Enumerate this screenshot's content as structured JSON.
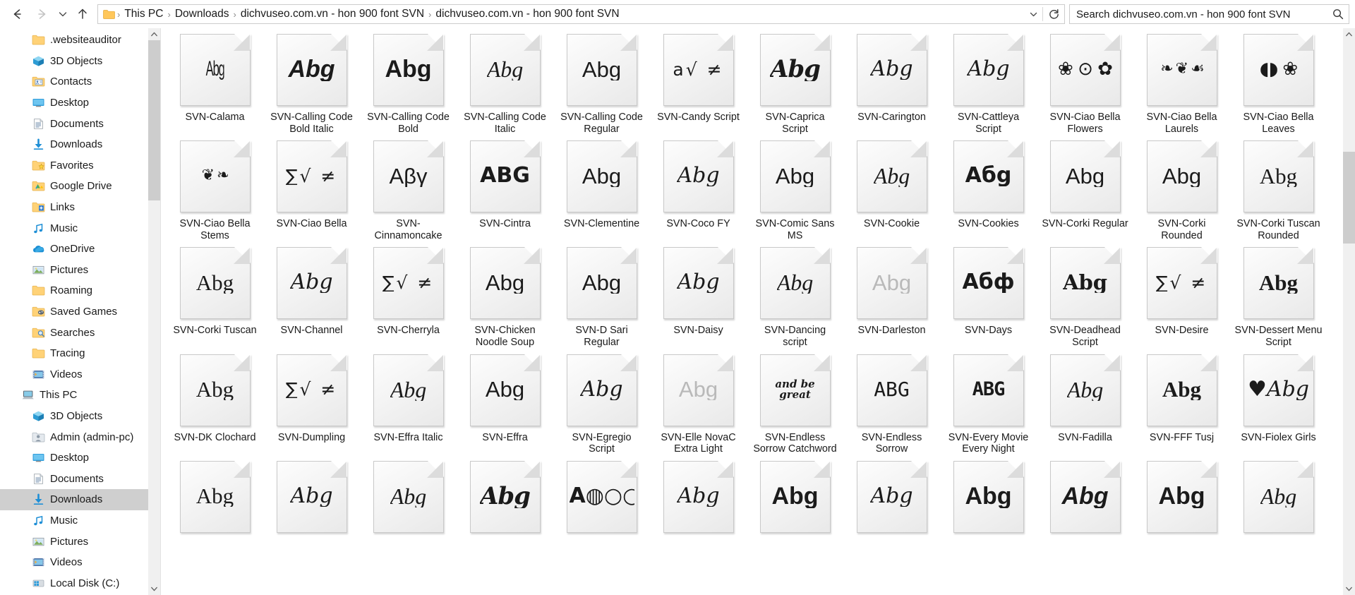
{
  "window": {
    "title": "dichvuseo.com.vn - hon 900 font SVN"
  },
  "toolbar": {
    "back_icon": "arrow-left-icon",
    "forward_icon": "arrow-right-icon",
    "recent_icon": "chevron-down-icon",
    "up_icon": "arrow-up-icon",
    "folder_icon": "folder-icon",
    "dropdown_icon": "chevron-down-icon",
    "refresh_icon": "refresh-icon",
    "search_icon": "search-icon"
  },
  "breadcrumb": {
    "separator": "›",
    "items": [
      "This PC",
      "Downloads",
      "dichvuseo.com.vn - hon 900 font SVN",
      "dichvuseo.com.vn - hon 900 font SVN"
    ]
  },
  "search": {
    "placeholder": "Search dichvuseo.com.vn - hon 900 font SVN",
    "value": ""
  },
  "sidebar": {
    "scroll_up_icon": "chevron-up-icon",
    "scroll_down_icon": "chevron-down-icon",
    "items": [
      {
        "label": ".websiteauditor",
        "icon": "folder-icon",
        "indent": 1,
        "selected": false
      },
      {
        "label": "3D Objects",
        "icon": "3d-objects-icon",
        "indent": 1,
        "selected": false
      },
      {
        "label": "Contacts",
        "icon": "contacts-icon",
        "indent": 1,
        "selected": false
      },
      {
        "label": "Desktop",
        "icon": "desktop-icon",
        "indent": 1,
        "selected": false
      },
      {
        "label": "Documents",
        "icon": "documents-icon",
        "indent": 1,
        "selected": false
      },
      {
        "label": "Downloads",
        "icon": "downloads-icon",
        "indent": 1,
        "selected": false
      },
      {
        "label": "Favorites",
        "icon": "favorites-icon",
        "indent": 1,
        "selected": false
      },
      {
        "label": "Google Drive",
        "icon": "google-drive-icon",
        "indent": 1,
        "selected": false
      },
      {
        "label": "Links",
        "icon": "links-icon",
        "indent": 1,
        "selected": false
      },
      {
        "label": "Music",
        "icon": "music-icon",
        "indent": 1,
        "selected": false
      },
      {
        "label": "OneDrive",
        "icon": "onedrive-icon",
        "indent": 1,
        "selected": false
      },
      {
        "label": "Pictures",
        "icon": "pictures-icon",
        "indent": 1,
        "selected": false
      },
      {
        "label": "Roaming",
        "icon": "folder-icon",
        "indent": 1,
        "selected": false
      },
      {
        "label": "Saved Games",
        "icon": "saved-games-icon",
        "indent": 1,
        "selected": false
      },
      {
        "label": "Searches",
        "icon": "searches-icon",
        "indent": 1,
        "selected": false
      },
      {
        "label": "Tracing",
        "icon": "folder-icon",
        "indent": 1,
        "selected": false
      },
      {
        "label": "Videos",
        "icon": "videos-icon",
        "indent": 1,
        "selected": false
      },
      {
        "label": "This PC",
        "icon": "this-pc-icon",
        "indent": 0,
        "selected": false
      },
      {
        "label": "3D Objects",
        "icon": "3d-objects-icon",
        "indent": 1,
        "selected": false
      },
      {
        "label": "Admin (admin-pc)",
        "icon": "user-folder-icon",
        "indent": 1,
        "selected": false
      },
      {
        "label": "Desktop",
        "icon": "desktop-icon",
        "indent": 1,
        "selected": false
      },
      {
        "label": "Documents",
        "icon": "documents-icon",
        "indent": 1,
        "selected": false
      },
      {
        "label": "Downloads",
        "icon": "downloads-icon",
        "indent": 1,
        "selected": true
      },
      {
        "label": "Music",
        "icon": "music-icon",
        "indent": 1,
        "selected": false
      },
      {
        "label": "Pictures",
        "icon": "pictures-icon",
        "indent": 1,
        "selected": false
      },
      {
        "label": "Videos",
        "icon": "videos-icon",
        "indent": 1,
        "selected": false
      },
      {
        "label": "Local Disk (C:)",
        "icon": "local-disk-icon",
        "indent": 1,
        "selected": false
      }
    ]
  },
  "content": {
    "scroll_up_icon": "chevron-up-icon",
    "scroll_down_icon": "chevron-down-icon",
    "view": "large-icons",
    "files": [
      {
        "name": "SVN-Calama",
        "preview": "Abg",
        "style": "p-cond"
      },
      {
        "name": "SVN-Calling Code Bold Italic",
        "preview": "Abg",
        "style": "p-bolditalic"
      },
      {
        "name": "SVN-Calling Code Bold",
        "preview": "Abg",
        "style": "p-bold"
      },
      {
        "name": "SVN-Calling Code Italic",
        "preview": "Abg",
        "style": "p-italic"
      },
      {
        "name": "SVN-Calling Code Regular",
        "preview": "Abg",
        "style": "p-reg"
      },
      {
        "name": "SVN-Candy Script",
        "preview": "a√ ≠",
        "style": "p-sym"
      },
      {
        "name": "SVN-Caprica Script",
        "preview": "Abg",
        "style": "p-fat"
      },
      {
        "name": "SVN-Carington",
        "preview": "Abg",
        "style": "p-scriptit"
      },
      {
        "name": "SVN-Cattleya Script",
        "preview": "Abg",
        "style": "p-scriptit"
      },
      {
        "name": "SVN-Ciao Bella Flowers",
        "preview": "❀ ⊙ ✿",
        "style": "p-orn"
      },
      {
        "name": "SVN-Ciao Bella Laurels",
        "preview": "❧ ❦ ☙",
        "style": "p-orn2"
      },
      {
        "name": "SVN-Ciao Bella Leaves",
        "preview": "◖◗ ❀",
        "style": "p-orn"
      },
      {
        "name": "SVN-Ciao Bella Stems",
        "preview": "❦ ❧",
        "style": "p-orn2"
      },
      {
        "name": "SVN-Ciao Bella",
        "preview": "∑√ ≠",
        "style": "p-sym"
      },
      {
        "name": "SVN-Cinnamoncake",
        "preview": "Aβγ",
        "style": "p-greek"
      },
      {
        "name": "SVN-Cintra",
        "preview": "ABG",
        "style": "p-wide"
      },
      {
        "name": "SVN-Clementine",
        "preview": "Abg",
        "style": "p-thin"
      },
      {
        "name": "SVN-Coco FY",
        "preview": "Abg",
        "style": "p-scriptit"
      },
      {
        "name": "SVN-Comic Sans MS",
        "preview": "Abg",
        "style": "p-reg"
      },
      {
        "name": "SVN-Cookie",
        "preview": "Abg",
        "style": "p-italic"
      },
      {
        "name": "SVN-Cookies",
        "preview": "Абg",
        "style": "p-cyr"
      },
      {
        "name": "SVN-Corki Regular",
        "preview": "Abg",
        "style": "p-reg"
      },
      {
        "name": "SVN-Corki Rounded",
        "preview": "Abg",
        "style": "p-reg"
      },
      {
        "name": "SVN-Corki Tuscan Rounded",
        "preview": "Abg",
        "style": "p-serif"
      },
      {
        "name": "SVN-Corki Tuscan",
        "preview": "Abg",
        "style": "p-serif"
      },
      {
        "name": "SVN-Channel",
        "preview": "Abg",
        "style": "p-scriptit"
      },
      {
        "name": "SVN-Cherryla",
        "preview": "∑√ ≠",
        "style": "p-sym"
      },
      {
        "name": "SVN-Chicken Noodle Soup",
        "preview": "Abg",
        "style": "p-reg"
      },
      {
        "name": "SVN-D Sari Regular",
        "preview": "Abg",
        "style": "p-reg"
      },
      {
        "name": "SVN-Daisy",
        "preview": "Abg",
        "style": "p-scriptit"
      },
      {
        "name": "SVN-Dancing script",
        "preview": "Abg",
        "style": "p-italic"
      },
      {
        "name": "SVN-Darleston",
        "preview": "Abg",
        "style": "p-light"
      },
      {
        "name": "SVN-Days",
        "preview": "Абф",
        "style": "p-cyr"
      },
      {
        "name": "SVN-Deadhead Script",
        "preview": "Abg",
        "style": "p-deco"
      },
      {
        "name": "SVN-Desire",
        "preview": "∑√ ≠",
        "style": "p-sym"
      },
      {
        "name": "SVN-Dessert Menu Script",
        "preview": "Abg",
        "style": "p-serifbold"
      },
      {
        "name": "SVN-DK Clochard",
        "preview": "Abg",
        "style": "p-serif"
      },
      {
        "name": "SVN-Dumpling",
        "preview": "∑√ ≠",
        "style": "p-sym"
      },
      {
        "name": "SVN-Effra Italic",
        "preview": "Abg",
        "style": "p-italic"
      },
      {
        "name": "SVN-Effra",
        "preview": "Abg",
        "style": "p-reg"
      },
      {
        "name": "SVN-Egregio Script",
        "preview": "Abg",
        "style": "p-scriptit"
      },
      {
        "name": "SVN-Elle NovaC Extra Light",
        "preview": "Abg",
        "style": "p-light"
      },
      {
        "name": "SVN-Endless Sorrow Catchword",
        "preview": "and be great",
        "style": "p-tiny"
      },
      {
        "name": "SVN-Endless Sorrow",
        "preview": "ABG",
        "style": "p-mono"
      },
      {
        "name": "SVN-Every Movie Every Night",
        "preview": "ABG",
        "style": "p-monob"
      },
      {
        "name": "SVN-Fadilla",
        "preview": "Abg",
        "style": "p-italic"
      },
      {
        "name": "SVN-FFF Tusj",
        "preview": "Abg",
        "style": "p-serifbold"
      },
      {
        "name": "SVN-Fiolex Girls",
        "preview": "♥Abg",
        "style": "p-scriptit"
      },
      {
        "name": "",
        "preview": "Abg",
        "style": "p-serif"
      },
      {
        "name": "",
        "preview": "Abg",
        "style": "p-scriptit"
      },
      {
        "name": "",
        "preview": "Abg",
        "style": "p-italic"
      },
      {
        "name": "",
        "preview": "Abg",
        "style": "p-fat"
      },
      {
        "name": "",
        "preview": "A◍○○",
        "style": "p-wide"
      },
      {
        "name": "",
        "preview": "Abg",
        "style": "p-scriptit"
      },
      {
        "name": "",
        "preview": "Abg",
        "style": "p-bold"
      },
      {
        "name": "",
        "preview": "Abg",
        "style": "p-scriptit"
      },
      {
        "name": "",
        "preview": "Abg",
        "style": "p-bold"
      },
      {
        "name": "",
        "preview": "Abg",
        "style": "p-bolditalic"
      },
      {
        "name": "",
        "preview": "Abg",
        "style": "p-bold"
      },
      {
        "name": "",
        "preview": "Abg",
        "style": "p-italic"
      }
    ]
  }
}
